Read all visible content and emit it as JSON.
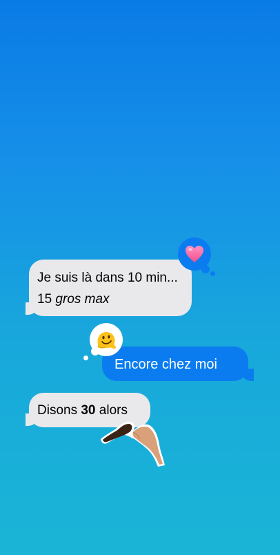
{
  "messages": [
    {
      "id": "m1",
      "direction": "incoming",
      "line1": "Je suis là dans 10 min...",
      "line2_prefix": "15 ",
      "line2_italic": "gros max",
      "reaction_icon": "heart-icon"
    },
    {
      "id": "m2",
      "direction": "outgoing",
      "text": "Encore chez moi",
      "reaction_icon": "melting-face-icon"
    },
    {
      "id": "m3",
      "direction": "incoming",
      "text_before": "Disons ",
      "text_bold": "30",
      "text_after": " alors",
      "sticker_icon": "heart-hands-icon"
    }
  ],
  "colors": {
    "background_top": "#0a7be6",
    "background_bottom": "#1ab5d6",
    "incoming_bubble": "#e9e9eb",
    "outgoing_bubble": "#0a7cf0",
    "heart": "#ff6fa8"
  }
}
